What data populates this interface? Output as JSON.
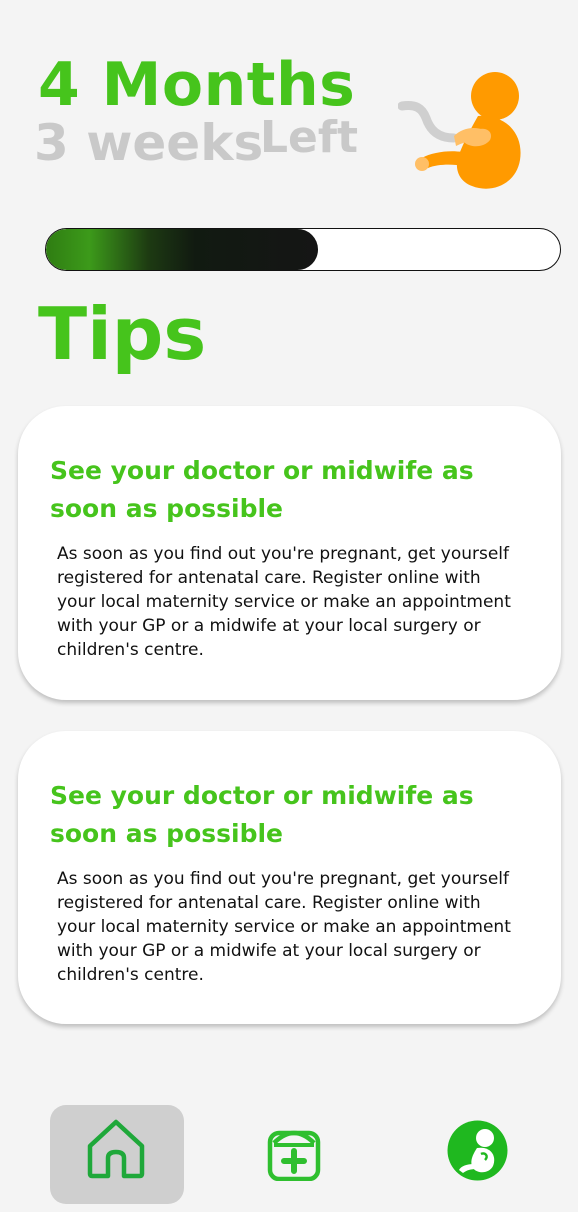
{
  "countdown": {
    "months": "4 Months",
    "weeks": "3 weeks",
    "left": "Left",
    "progress_fraction": 0.53
  },
  "icons": {
    "fetus": "fetus-icon",
    "home": "home-icon",
    "medical": "medical-kit-icon",
    "baby": "baby-icon"
  },
  "colors": {
    "accent": "#46c41c",
    "muted": "#c9c9c9",
    "fetus": "#ff9a00"
  },
  "tips": {
    "title": "Tips",
    "cards": [
      {
        "title": "See your doctor or midwife as soon as possible",
        "body": "As soon as you find out you're pregnant, get yourself registered for antenatal care. Register online with your local maternity service or make an appointment with your GP or a midwife at your local surgery or children's centre."
      },
      {
        "title": "See your doctor or midwife as soon as possible",
        "body": "As soon as you find out you're pregnant, get yourself registered for antenatal care. Register online with your local maternity service or make an appointment with your GP or a midwife at your local surgery or children's centre."
      }
    ]
  }
}
